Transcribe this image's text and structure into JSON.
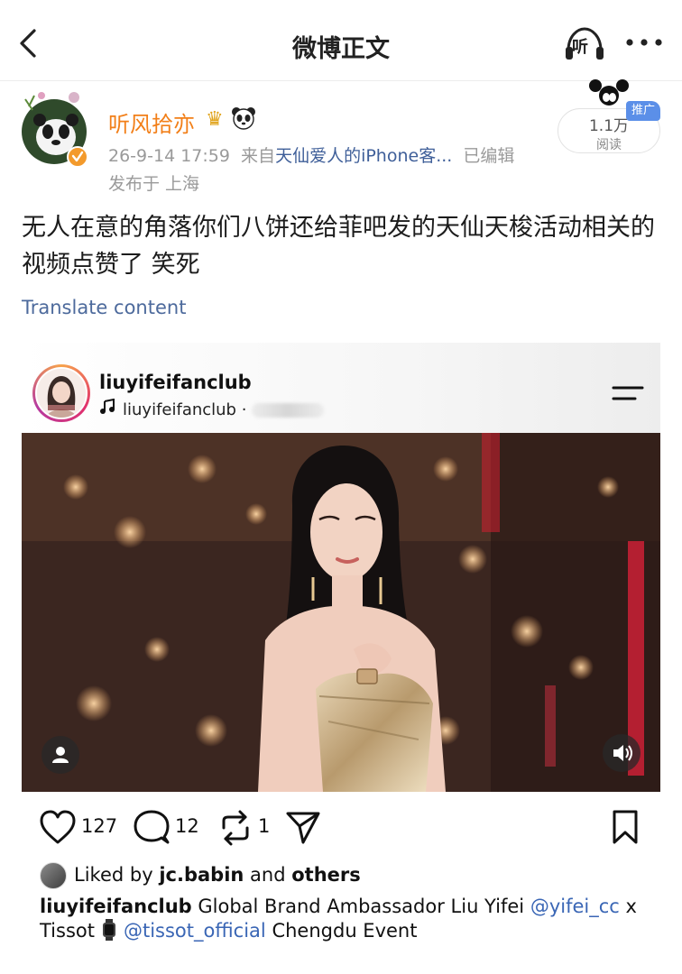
{
  "nav": {
    "title": "微博正文",
    "listen_label": "听"
  },
  "author": {
    "name": "听风拾亦",
    "timestamp": "26-9-14 17:59",
    "source_prefix": "来自",
    "source": "天仙爱人的iPhone客...",
    "edited": "已编辑",
    "location": "发布于 上海"
  },
  "reads": {
    "count": "1.1万",
    "label": "阅读",
    "promo": "推广"
  },
  "post": {
    "text": "无人在意的角落你们八饼还给菲吧发的天仙天梭活动相关的视频点赞了 笑死",
    "translate": "Translate content"
  },
  "embed": {
    "username": "liuyifeifanclub",
    "audio": "liuyifeifanclub ·",
    "likes": "127",
    "comments": "12",
    "reposts": "1",
    "liked_by_prefix": "Liked by",
    "liked_by_user": "jc.babin",
    "liked_by_and": "and",
    "liked_by_others": "others",
    "caption_user": "liuyifeifanclub",
    "caption_text_1": "Global Brand Ambassador Liu Yifei",
    "caption_mention_1": "@yifei_cc",
    "caption_x": "x",
    "caption_brand": "Tissot",
    "caption_mention_2": "@tissot_official",
    "caption_text_2": "Chengdu Event"
  },
  "colors": {
    "author_orange": "#f27f18",
    "link_blue": "#3f5f99",
    "mention_blue": "#3a66b5",
    "promo_blue": "#5b8fe8"
  },
  "icons": [
    "back-arrow-icon",
    "listen-headphone-icon",
    "more-dots-icon",
    "crown-icon",
    "panda-icon",
    "verified-icon",
    "mickey-icon",
    "music-note-icon",
    "menu-lines-icon",
    "person-icon",
    "sound-icon",
    "heart-icon",
    "comment-icon",
    "repost-icon",
    "share-icon",
    "bookmark-icon",
    "watch-icon"
  ]
}
